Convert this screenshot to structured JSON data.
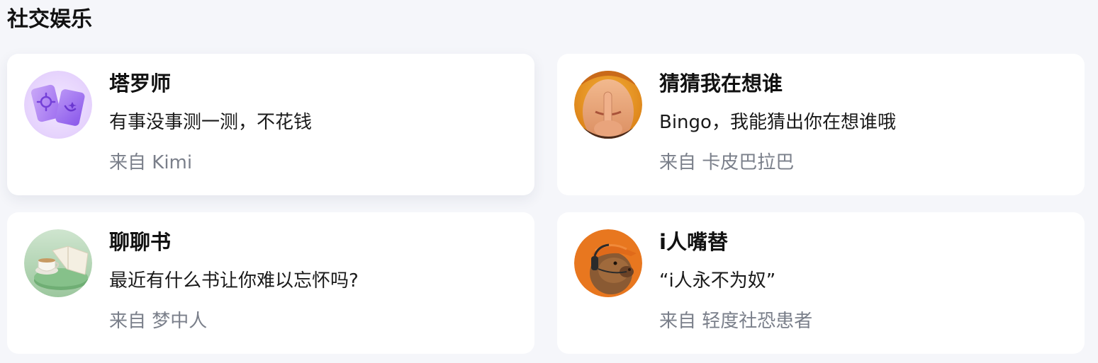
{
  "section": {
    "title": "社交娱乐"
  },
  "cards": [
    {
      "title": "塔罗师",
      "description": "有事没事测一测，不花钱",
      "source": "来自 Kimi",
      "avatar_icon": "tarot-cards-icon"
    },
    {
      "title": "猜猜我在想谁",
      "description": "Bingo，我能猜出你在想谁哦",
      "source": "来自 卡皮巴拉巴",
      "avatar_icon": "shush-person-icon"
    },
    {
      "title": "聊聊书",
      "description": "最近有什么书让你难以忘怀吗?",
      "source": "来自 梦中人",
      "avatar_icon": "book-and-tea-icon"
    },
    {
      "title": "i人嘴替",
      "description": "“i人永不为奴”",
      "source": "来自 轻度社恐患者",
      "avatar_icon": "capybara-headphones-icon"
    }
  ],
  "colors": {
    "page_background": "#f5f6fa",
    "card_background": "#ffffff",
    "source_text": "#7a7f8a",
    "tarot_purple": "#a57af0",
    "capybara_orange": "#e8771f"
  }
}
